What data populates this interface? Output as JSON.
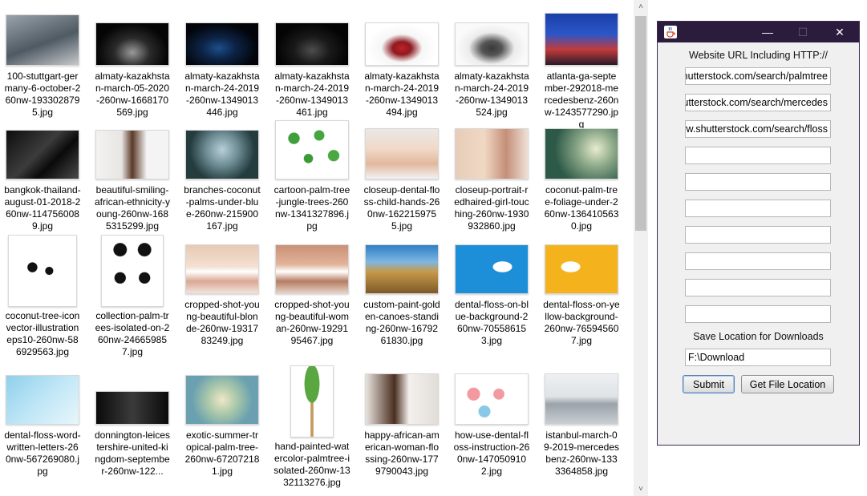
{
  "files": [
    {
      "name": "100-stuttgart-germany-6-october-260nw-1933028795.jpg",
      "thumb": {
        "w": 90,
        "h": 62,
        "bg": "linear-gradient(160deg,#9aa3ab,#4f5a63 55%,#c6c9cc)"
      }
    },
    {
      "name": "almaty-kazakhstan-march-05-2020-260nw-1668170569.jpg",
      "thumb": {
        "w": 90,
        "h": 52,
        "bg": "radial-gradient(ellipse at 50% 70%,#9a9a9a 0,#2a2a2a 35%,#050505 70%)"
      }
    },
    {
      "name": "almaty-kazakhstan-march-24-2019-260nw-1349013446.jpg",
      "thumb": {
        "w": 90,
        "h": 52,
        "bg": "radial-gradient(ellipse at 45% 60%,#1d4e8a 0,#0d2447 30%,#020409 70%)"
      }
    },
    {
      "name": "almaty-kazakhstan-march-24-2019-260nw-1349013461.jpg",
      "thumb": {
        "w": 90,
        "h": 52,
        "bg": "radial-gradient(ellipse at 50% 65%,#4d4d4d 0,#1a1a1a 35%,#040404 70%)"
      }
    },
    {
      "name": "almaty-kazakhstan-march-24-2019-260nw-1349013494.jpg",
      "thumb": {
        "w": 90,
        "h": 52,
        "bg": "radial-gradient(ellipse at 50% 60%,#c0212a 0,#8e1a20 18%,#f6f6f6 40%,#ffffff 70%)"
      }
    },
    {
      "name": "almaty-kazakhstan-march-24-2019-260nw-1349013524.jpg",
      "thumb": {
        "w": 90,
        "h": 52,
        "bg": "radial-gradient(ellipse at 50% 60%,#3a3a3a 0,#555 20%,#ececec 45%,#fafafa 70%)"
      }
    },
    {
      "name": "atlanta-ga-september-292018-mercedesbenz-260nw-1243577290.jpg",
      "thumb": {
        "w": 90,
        "h": 64,
        "bg": "linear-gradient(180deg,#1a3fa8 0,#2c56c9 40%,#c23b3b 70%,#2a1a2a 100%)"
      }
    },
    {
      "name": "bangkok-thailand-august-01-2018-260nw-1147560089.jpg",
      "thumb": {
        "w": 90,
        "h": 60,
        "bg": "linear-gradient(135deg,#0d0d0d,#3c3c3c 45%,#0a0a0a 65%,#4a4a4a)"
      }
    },
    {
      "name": "beautiful-smiling-african-ethnicity-young-260nw-1685315299.jpg",
      "thumb": {
        "w": 90,
        "h": 60,
        "bg": "linear-gradient(90deg,#f2f2f2 0,#e8e6e3 35%,#5a3a28 50%,#f4f4f4 70%)"
      }
    },
    {
      "name": "branches-coconut-palms-under-blue-260nw-215900167.jpg",
      "thumb": {
        "w": 90,
        "h": 60,
        "bg": "radial-gradient(circle at 50% 40%,#b8cfd8 0,#6d8c94 35%,#243c3e 70%)"
      }
    },
    {
      "name": "cartoon-palm-tree-jungle-trees-260nw-1341327896.jpg",
      "thumb": {
        "w": 90,
        "h": 72,
        "bg": "radial-gradient(circle at 25% 30%,#3f9f3a 0 8%,transparent 9%),radial-gradient(circle at 60% 25%,#45a53e 0 8%,transparent 9%),radial-gradient(circle at 45% 65%,#3c9a36 0 8%,transparent 9%),radial-gradient(circle at 80% 60%,#4aa843 0 8%,transparent 9%),#ffffff"
      }
    },
    {
      "name": "closeup-dental-floss-child-hands-260nw-1622159755.jpg",
      "thumb": {
        "w": 90,
        "h": 62,
        "bg": "linear-gradient(180deg,#eae8e6 0,#f1d9c7 40%,#e2b89e 70%,#f2f2f2)"
      }
    },
    {
      "name": "closeup-portrait-redhaired-girl-touching-260nw-1930932860.jpg",
      "thumb": {
        "w": 90,
        "h": 62,
        "bg": "linear-gradient(90deg,#e7cdb8 0,#f0d8c4 40%,#c48f78 70%,#efe1d6)"
      }
    },
    {
      "name": "coconut-palm-tree-foliage-under-260nw-1364105630.jpg",
      "thumb": {
        "w": 90,
        "h": 62,
        "bg": "radial-gradient(circle at 70% 40%,#e8eccf 0,#8eaa8a 30%,#2d5a48 70%)"
      }
    },
    {
      "name": "coconut-tree-iconvector-illustrationeps10-260nw-586929563.jpg",
      "thumb": {
        "w": 84,
        "h": 88,
        "bg": "radial-gradient(circle at 35% 45%,#111 0 8%,transparent 9%),radial-gradient(circle at 60% 50%,#111 0 7%,transparent 8%),#ffffff"
      }
    },
    {
      "name": "collection-palm-trees-isolated-on-260nw-246659857.jpg",
      "thumb": {
        "w": 76,
        "h": 88,
        "bg": "radial-gradient(circle at 30% 20%,#111 0 9%,transparent 10%),radial-gradient(circle at 70% 20%,#111 0 9%,transparent 10%),radial-gradient(circle at 30% 60%,#111 0 9%,transparent 10%),radial-gradient(circle at 70% 60%,#111 0 9%,transparent 10%),#ffffff"
      }
    },
    {
      "name": "cropped-shot-young-beautiful-blonde-260nw-1931783249.jpg",
      "thumb": {
        "w": 90,
        "h": 60,
        "bg": "linear-gradient(180deg,#e7c9b4 0,#f4e0d2 45%,#ffffff 55%,#d9a894 75%,#f2e4dc)"
      }
    },
    {
      "name": "cropped-shot-young-beautiful-woman-260nw-1929195467.jpg",
      "thumb": {
        "w": 90,
        "h": 60,
        "bg": "linear-gradient(180deg,#c99176 0,#e2b39a 40%,#ffffff 55%,#b77c62 75%,#e8d3c8)"
      }
    },
    {
      "name": "custom-paint-golden-canoes-standing-260nw-1679261830.jpg",
      "thumb": {
        "w": 90,
        "h": 60,
        "bg": "linear-gradient(180deg,#2e7fc6 0,#7fb6e0 35%,#c79a4a 55%,#7e5a28 100%)"
      }
    },
    {
      "name": "dental-floss-on-blue-background-260nw-705586153.jpg",
      "thumb": {
        "w": 90,
        "h": 60,
        "bg": "radial-gradient(ellipse at 65% 45%,#ffffff 0 14%,transparent 15%),#1d8ed8"
      }
    },
    {
      "name": "dental-floss-on-yellow-background-260nw-765945607.jpg",
      "thumb": {
        "w": 90,
        "h": 60,
        "bg": "radial-gradient(ellipse at 35% 45%,#ffffff 0 14%,transparent 15%),#f4b21d"
      }
    },
    {
      "name": "dental-floss-word-written-letters-260nw-567269080.jpg",
      "thumb": {
        "w": 90,
        "h": 60,
        "bg": "linear-gradient(135deg,#8fd0ec 0,#bfe6f6 50%,#e8f6fb)"
      }
    },
    {
      "name": "donnington-leicestershire-united-kingdom-september-260nw-122...",
      "thumb": {
        "w": 90,
        "h": 40,
        "bg": "linear-gradient(90deg,#0a0a0a,#3b3b3b 50%,#0a0a0a)"
      }
    },
    {
      "name": "exotic-summer-tropical-palm-tree-260nw-672072181.jpg",
      "thumb": {
        "w": 90,
        "h": 60,
        "bg": "radial-gradient(circle at 50% 50%,#f0e7c6 0,#a7c7a9 35%,#6aa0b0 70%)"
      }
    },
    {
      "name": "hand-painted-watercolor-palmtree-isolated-260nw-1332113276.jpg",
      "thumb": {
        "w": 52,
        "h": 88,
        "bg": "radial-gradient(ellipse at 50% 25%,#5aa640 0 25%,transparent 26%),linear-gradient(90deg,#fff 46%,#c59a5a 47% 53%,#fff 54%)"
      }
    },
    {
      "name": "happy-african-american-woman-flossing-260nw-1779790043.jpg",
      "thumb": {
        "w": 90,
        "h": 62,
        "bg": "linear-gradient(90deg,#e9e4df 0,#4a2e1f 40%,#f3f0ed 60%,#e2ddd8)"
      }
    },
    {
      "name": "how-use-dental-floss-instruction-260nw-1470509102.jpg",
      "thumb": {
        "w": 90,
        "h": 62,
        "bg": "radial-gradient(circle at 25% 40%,#f29aa0 0 10%,transparent 11%),radial-gradient(circle at 60% 40%,#f29aa0 0 10%,transparent 11%),radial-gradient(circle at 40% 75%,#8ac8e8 0 10%,transparent 11%),#ffffff"
      }
    },
    {
      "name": "istanbul-march-09-2019-mercedesbenz-260nw-1333364858.jpg",
      "thumb": {
        "w": 90,
        "h": 62,
        "bg": "linear-gradient(180deg,#eef0f2 0,#dfe3e6 45%,#9aa3aa 60%,#c9ced2)"
      }
    }
  ],
  "scrollbar": {
    "up": "˄",
    "down": "˅"
  },
  "window": {
    "icon": "java-cup-icon",
    "controls": {
      "minimize": "—",
      "maximize": "☐",
      "close": "✕"
    },
    "url_label": "Website URL Including HTTP://",
    "urls": [
      "https://www.shutterstock.com/search/palmtree",
      "https://www.shutterstock.com/search/mercedes",
      "https://www.shutterstock.com/search/floss",
      "",
      "",
      "",
      "",
      "",
      "",
      ""
    ],
    "save_label": "Save Location for Downloads",
    "save_path": "F:\\Download",
    "submit": "Submit",
    "get_location": "Get File Location",
    "title_color": "#2b1b3d"
  }
}
